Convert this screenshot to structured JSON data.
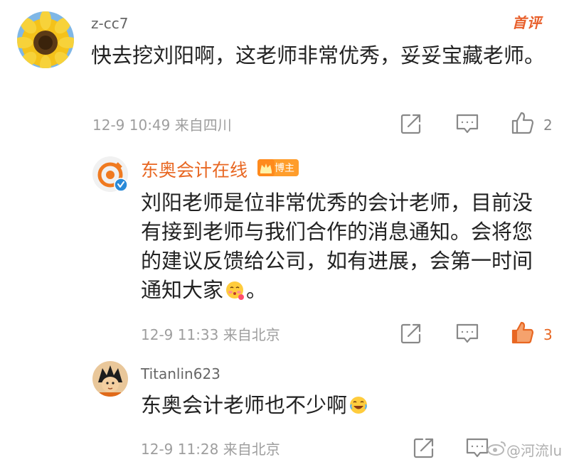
{
  "comments": [
    {
      "username": "z-cc7",
      "first_badge": "首评",
      "text": "快去挖刘阳啊，这老师非常优秀，妥妥宝藏老师。",
      "meta": "12-9 10:49 来自四川",
      "like_count": "2"
    },
    {
      "username": "东奥会计在线",
      "author_badge": "博主",
      "text": "刘阳老师是位非常优秀的会计老师，目前没有接到老师与我们合作的消息通知。会将您的建议反馈给公司，如有进展，会第一时间通知大家",
      "text_end": "。",
      "meta": "12-9 11:33 来自北京",
      "like_count": "3"
    },
    {
      "username": "Titanlin623",
      "text": "东奥会计老师也不少啊",
      "meta": "12-9 11:28 来自北京"
    }
  ],
  "watermark": "@河流lu",
  "colors": {
    "accent": "#e86722",
    "meta_gray": "#9e9e9e",
    "text": "#222222"
  },
  "icons": {
    "share": "share-icon",
    "comment": "comment-icon",
    "like": "thumbs-up-icon",
    "like_active": "thumbs-up-filled-icon",
    "verified": "verified-badge-icon",
    "emoji_blush": "blushing-emoji-icon",
    "emoji_laugh": "laughing-emoji-icon",
    "weibo": "weibo-logo-icon"
  }
}
